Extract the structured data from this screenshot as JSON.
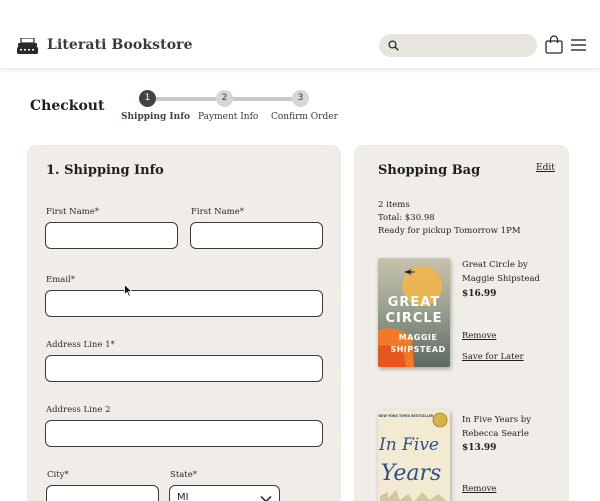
{
  "header": {
    "brand": "Literati Bookstore",
    "search_placeholder": "",
    "icons": [
      "typewriter-icon",
      "search-icon",
      "shopping-bag-icon",
      "hamburger-menu-icon"
    ]
  },
  "checkout": {
    "title": "Checkout",
    "steps": [
      {
        "number": "1",
        "label": "Shipping Info",
        "active": true
      },
      {
        "number": "2",
        "label": "Payment Info",
        "active": false
      },
      {
        "number": "3",
        "label": "Confirm Order",
        "active": false
      }
    ]
  },
  "shipping": {
    "title": "1. Shipping Info",
    "first_name_label": "First Name*",
    "last_name_label": "First Name*",
    "email_label": "Email*",
    "address1_label": "Address Line 1*",
    "address2_label": "Address Line 2",
    "city_label": "City*",
    "state_label": "State*",
    "state_value": "MI",
    "values": {
      "first_name": "",
      "last_name": "",
      "email": "",
      "address1": "",
      "address2": "",
      "city": ""
    }
  },
  "bag": {
    "title": "Shopping Bag",
    "edit_label": "Edit",
    "item_count": "2 items",
    "total": "Total: $30.98",
    "pickup": "Ready for pickup Tomorrow 1PM",
    "items": [
      {
        "title_line1": "Great Circle by",
        "title_line2": "Maggie Shipstead",
        "price": "$16.99",
        "remove_label": "Remove",
        "save_label": "Save for Later",
        "cover_title_1": "GREAT",
        "cover_title_2": "CIRCLE",
        "cover_author_1": "MAGGIE",
        "cover_author_2": "SHIPSTEAD"
      },
      {
        "title_line1": "In Five Years by",
        "title_line2": "Rebecca Searle",
        "price": "$13.99",
        "remove_label": "Remove",
        "cover_banner": "NEW YORK TIMES BESTSELLER",
        "cover_title_1": "In Five",
        "cover_title_2": "Years"
      }
    ]
  },
  "colors": {
    "accent": "#3e463e",
    "card_bg": "#f0ece7",
    "search_bg": "#e8e4de",
    "step_inactive": "#d6d6d6"
  }
}
